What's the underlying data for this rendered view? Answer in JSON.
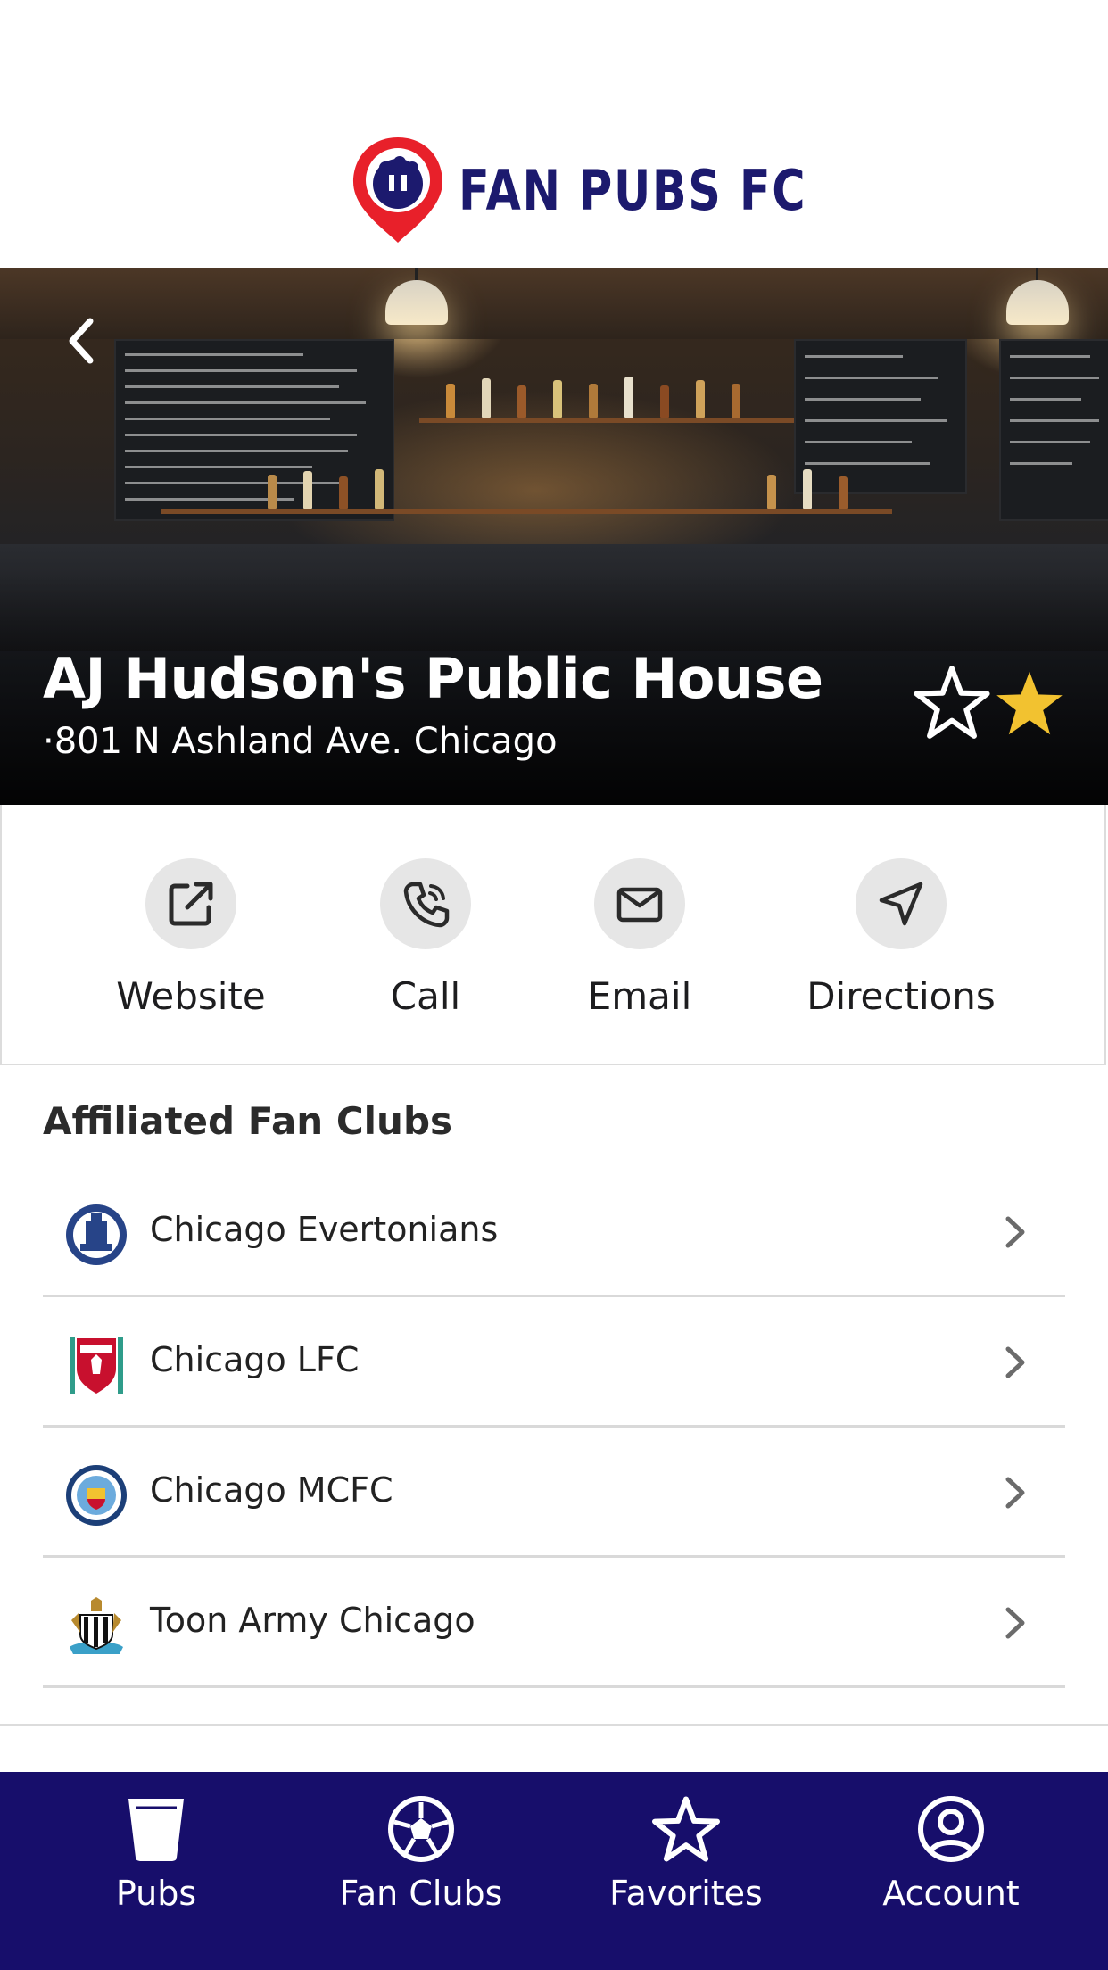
{
  "app": {
    "logo_text": "FAN PUBS FC"
  },
  "pub": {
    "name": "AJ Hudson's Public House",
    "address": "·801 N Ashland Ave. Chicago"
  },
  "actions": [
    {
      "label": "Website",
      "icon": "external-link-icon"
    },
    {
      "label": "Call",
      "icon": "phone-icon"
    },
    {
      "label": "Email",
      "icon": "mail-icon"
    },
    {
      "label": "Directions",
      "icon": "navigation-icon"
    }
  ],
  "fan_clubs": {
    "title": "Affiliated Fan Clubs",
    "items": [
      {
        "name": "Chicago Evertonians",
        "icon": "everton-crest-icon"
      },
      {
        "name": "Chicago LFC",
        "icon": "liverpool-crest-icon"
      },
      {
        "name": "Chicago MCFC",
        "icon": "man-city-crest-icon"
      },
      {
        "name": "Toon Army Chicago",
        "icon": "newcastle-crest-icon"
      }
    ]
  },
  "tabbar": {
    "items": [
      {
        "label": "Pubs",
        "icon": "glass-icon"
      },
      {
        "label": "Fan Clubs",
        "icon": "soccer-ball-icon"
      },
      {
        "label": "Favorites",
        "icon": "star-icon"
      },
      {
        "label": "Account",
        "icon": "user-circle-icon"
      }
    ]
  },
  "colors": {
    "brand_navy": "#170e6b",
    "logo_red": "#e8202a",
    "favorite_gold": "#f2c230",
    "action_circle": "#e6e6e6"
  }
}
